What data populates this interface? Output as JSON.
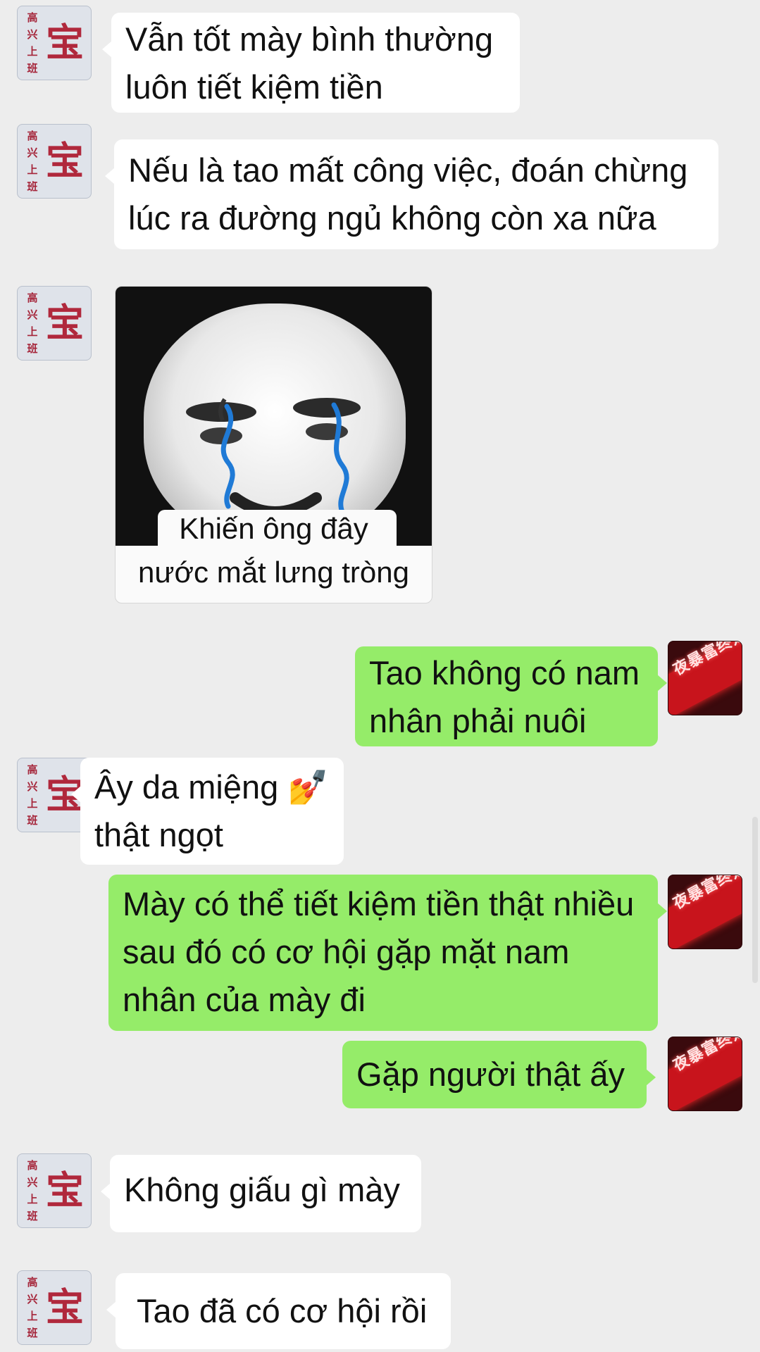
{
  "contact": {
    "avatar_glyph": "宝",
    "avatar_side_text": [
      "高",
      "高",
      "兴",
      "兴",
      "上",
      "班"
    ]
  },
  "me": {
    "avatar_text": "夜暴富终是梦"
  },
  "messages": [
    {
      "from": "them",
      "type": "text",
      "lines": [
        "Vẫn tốt mày bình thường",
        "luôn tiết kiệm tiền"
      ]
    },
    {
      "from": "them",
      "type": "text",
      "lines": [
        "Nếu là tao mất công việc, đoán chừng",
        "lúc ra đường ngủ không còn xa nữa"
      ]
    },
    {
      "from": "them",
      "type": "sticker",
      "lines": [
        "Khiến ông đây",
        "nước mắt lưng tròng"
      ]
    },
    {
      "from": "me",
      "type": "text",
      "lines": [
        "Tao không có nam",
        "nhân phải nuôi"
      ]
    },
    {
      "from": "them",
      "type": "text",
      "lines": [
        "Ây da miệng 💅",
        "thật ngọt"
      ]
    },
    {
      "from": "me",
      "type": "text",
      "lines": [
        "Mày có thể tiết kiệm tiền thật nhiều",
        "sau đó có cơ hội gặp mặt nam",
        "nhân của mày đi"
      ]
    },
    {
      "from": "me",
      "type": "text",
      "lines": [
        "Gặp người thật ấy"
      ]
    },
    {
      "from": "them",
      "type": "text",
      "lines": [
        "Không giấu gì mày"
      ]
    },
    {
      "from": "them",
      "type": "text",
      "lines": [
        "Tao đã có cơ hội rồi"
      ]
    }
  ],
  "colors": {
    "background": "#ededed",
    "incoming_bubble": "#ffffff",
    "outgoing_bubble": "#95ec69",
    "tear": "#1f7ad6"
  }
}
